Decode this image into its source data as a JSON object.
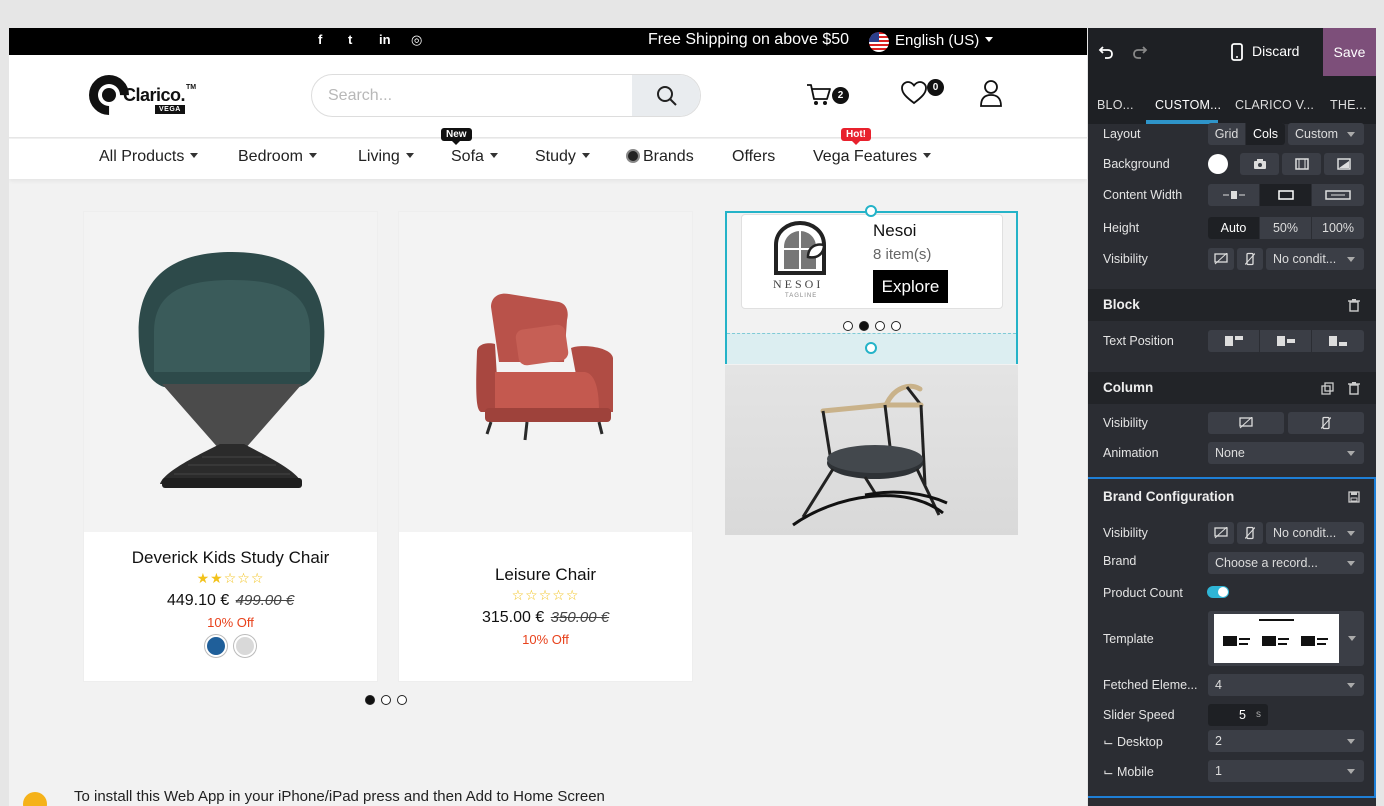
{
  "site": {
    "topbar": {
      "social_icons": [
        "facebook-icon",
        "twitter-icon",
        "linkedin-icon",
        "instagram-icon"
      ],
      "social_glyphs": [
        "f",
        "t",
        "in",
        "◎"
      ],
      "shipping_text": "Free Shipping on above $50",
      "language": "English (US)"
    },
    "header": {
      "logo_word": "Clarico.",
      "logo_tm": "TM",
      "logo_sub": "VEGA",
      "search_placeholder": "Search...",
      "cart_count": "2",
      "wishlist_count": "0"
    },
    "nav": {
      "items": [
        {
          "label": "All Products"
        },
        {
          "label": "Bedroom"
        },
        {
          "label": "Living"
        },
        {
          "label": "Sofa",
          "badge": "New"
        },
        {
          "label": "Study"
        },
        {
          "label": "Brands"
        },
        {
          "label": "Offers"
        },
        {
          "label": "Vega Features",
          "badge": "Hot!"
        }
      ]
    },
    "products": [
      {
        "title": "Deverick Kids Study Chair",
        "stars": "★★☆☆☆",
        "rating": 2,
        "price": "449.10 €",
        "old_price": "499.00 €",
        "discount": "10% Off",
        "swatch_colors": [
          "#1f5f9a",
          "#d9d9d9"
        ]
      },
      {
        "title": "Leisure Chair",
        "stars": "☆☆☆☆☆",
        "rating": 0,
        "price": "315.00 €",
        "old_price": "350.00 €",
        "discount": "10% Off"
      }
    ],
    "brand_card": {
      "name": "Nesoi",
      "count": "8 item(s)",
      "button": "Explore",
      "logo_text": "NESOI",
      "logo_tagline": "TAGLINE"
    },
    "install_text": "To install this Web App in your iPhone/iPad press   and then Add to Home Screen",
    "colors": {
      "accent": "#24b3c8",
      "discount": "#e8421c",
      "star": "#f2c21b",
      "hot_badge": "#e8212d"
    }
  },
  "panel": {
    "discard": "Discard",
    "save": "Save",
    "tabs": [
      "BLO...",
      "CUSTOM...",
      "CLARICO V...",
      "THE..."
    ],
    "active_tab": "CUSTOM...",
    "rows": {
      "layout": {
        "label": "Layout",
        "options": [
          "Grid",
          "Cols"
        ],
        "active": "Cols",
        "select": "Custom"
      },
      "background": {
        "label": "Background"
      },
      "content_width": {
        "label": "Content Width"
      },
      "height": {
        "label": "Height",
        "options": [
          "Auto",
          "50%",
          "100%"
        ],
        "active": "Auto"
      },
      "visibility": {
        "label": "Visibility",
        "select": "No condit..."
      }
    },
    "block": {
      "title": "Block",
      "text_position_label": "Text Position"
    },
    "column": {
      "title": "Column",
      "visibility_label": "Visibility",
      "animation_label": "Animation",
      "animation_value": "None"
    },
    "brand_config": {
      "title": "Brand Configuration",
      "visibility_label": "Visibility",
      "visibility_value": "No condit...",
      "brand_label": "Brand",
      "brand_value": "Choose a record...",
      "product_count_label": "Product Count",
      "product_count_on": true,
      "template_label": "Template",
      "fetched_label": "Fetched Eleme...",
      "fetched_value": "4",
      "slider_label": "Slider Speed",
      "slider_value": "5",
      "slider_unit": "s",
      "desktop_label": "⌙ Desktop",
      "desktop_value": "2",
      "mobile_label": "⌙ Mobile",
      "mobile_value": "1"
    },
    "colors": {
      "save_bg": "#7d4f7a",
      "tab_underline": "#2e94c9",
      "highlight_border": "#1e7fd6"
    }
  }
}
